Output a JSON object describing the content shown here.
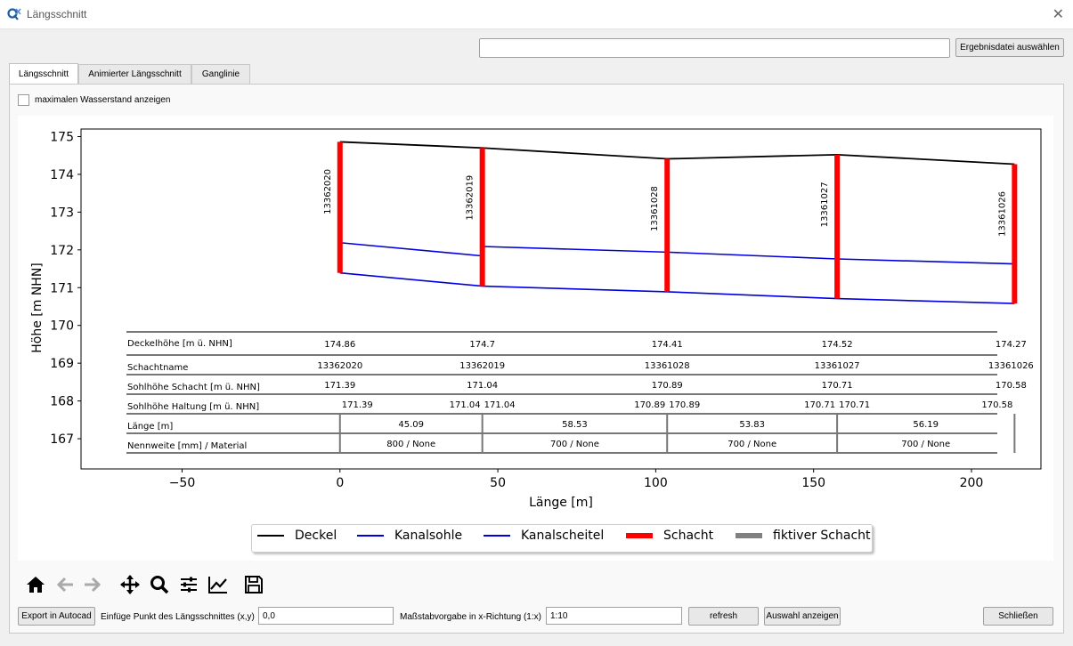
{
  "window": {
    "title": "Längsschnitt",
    "close_symbol": "✕"
  },
  "header": {
    "result_file_value": "",
    "select_result_button": "Ergebnisdatei auswählen"
  },
  "tabs": [
    {
      "label": "Längsschnitt",
      "active": true
    },
    {
      "label": "Animierter Längsschnitt",
      "active": false
    },
    {
      "label": "Ganglinie",
      "active": false
    }
  ],
  "options": {
    "max_water_label": "maximalen Wasserstand anzeigen",
    "max_water_checked": false
  },
  "chart_data": {
    "type": "line",
    "xlabel": "Länge [m]",
    "ylabel": "Höhe [m NHN]",
    "xlim": [
      -82,
      222
    ],
    "ylim": [
      166.2,
      175.2
    ],
    "x_ticks": [
      -50,
      0,
      50,
      100,
      150,
      200
    ],
    "x_tick_labels": [
      "−50",
      "0",
      "50",
      "100",
      "150",
      "200"
    ],
    "y_ticks": [
      167,
      168,
      169,
      170,
      171,
      172,
      173,
      174,
      175
    ],
    "y_tick_labels": [
      "167",
      "168",
      "169",
      "170",
      "171",
      "172",
      "173",
      "174",
      "175"
    ],
    "colors": {
      "deckel": "#000000",
      "kanal": "#0000dd",
      "schacht": "#ff0000",
      "fiktiv": "#808080"
    },
    "series": [
      {
        "name": "Deckel",
        "x": [
          0,
          45.09,
          103.62,
          157.45,
          213.64
        ],
        "y": [
          174.86,
          174.7,
          174.41,
          174.52,
          174.27
        ]
      },
      {
        "name": "Kanalsohle",
        "segments": [
          {
            "x": [
              0,
              45.09
            ],
            "y": [
              171.39,
              171.04
            ]
          },
          {
            "x": [
              45.09,
              103.62
            ],
            "y": [
              171.04,
              170.89
            ]
          },
          {
            "x": [
              103.62,
              157.45
            ],
            "y": [
              170.89,
              170.71
            ]
          },
          {
            "x": [
              157.45,
              213.64
            ],
            "y": [
              170.71,
              170.58
            ]
          }
        ]
      },
      {
        "name": "Kanalscheitel",
        "segments": [
          {
            "x": [
              0,
              45.09
            ],
            "y": [
              172.19,
              171.84
            ]
          },
          {
            "x": [
              45.09,
              103.62
            ],
            "y": [
              172.09,
              171.94
            ]
          },
          {
            "x": [
              103.62,
              157.45
            ],
            "y": [
              171.94,
              171.76
            ]
          },
          {
            "x": [
              157.45,
              213.64
            ],
            "y": [
              171.76,
              171.63
            ]
          }
        ]
      }
    ],
    "manholes": [
      {
        "name": "13362020",
        "x": 0,
        "top": 174.86,
        "bottom": 171.39
      },
      {
        "name": "13362019",
        "x": 45.09,
        "top": 174.7,
        "bottom": 171.04
      },
      {
        "name": "13361028",
        "x": 103.62,
        "top": 174.41,
        "bottom": 170.89
      },
      {
        "name": "13361027",
        "x": 157.45,
        "top": 174.52,
        "bottom": 170.71
      },
      {
        "name": "13361026",
        "x": 213.64,
        "top": 174.27,
        "bottom": 170.58
      }
    ],
    "legend": [
      "Deckel",
      "Kanalsohle",
      "Kanalscheitel",
      "Schacht",
      "fiktiver Schacht"
    ],
    "legend_placement": "bottom-center",
    "table": {
      "row_labels": [
        "Deckelhöhe [m ü. NHN]",
        "Schachtname",
        "Sohlhöhe Schacht [m ü. NHN]",
        "Sohlhöhe Haltung [m ü. NHN]",
        "Länge [m]",
        "Nennweite [mm] / Material"
      ],
      "deckelhoehe": [
        "174.86",
        "174.7",
        "174.41",
        "174.52",
        "174.27"
      ],
      "schachtname": [
        "13362020",
        "13362019",
        "13361028",
        "13361027",
        "13361026"
      ],
      "sohlhoehe_schacht": [
        "171.39",
        "171.04",
        "170.89",
        "170.71",
        "170.58"
      ],
      "sohlhoehe_haltung": [
        [
          "171.39",
          "171.04"
        ],
        [
          "171.04",
          "170.89"
        ],
        [
          "170.89",
          "170.71"
        ],
        [
          "170.71",
          "170.58"
        ]
      ],
      "laenge": [
        "45.09",
        "58.53",
        "53.83",
        "56.19"
      ],
      "nennweite": [
        "800 / None",
        "700 / None",
        "700 / None",
        "700 / None"
      ]
    }
  },
  "toolbar": {
    "icons": [
      "home-icon",
      "back-icon",
      "forward-icon",
      "pan-icon",
      "zoom-icon",
      "configure-subplots-icon",
      "axes-edit-icon",
      "save-icon"
    ]
  },
  "footer": {
    "export_button": "Export in Autocad",
    "insert_point_label": "Einfüge Punkt des Längsschnittes (x,y)",
    "insert_point_value": "0,0",
    "scale_label": "Maßstabvorgabe in x-Richtung (1:x)",
    "scale_value": "1:10",
    "refresh_button": "refresh",
    "show_selection_button": "Auswahl anzeigen",
    "close_button": "Schließen"
  }
}
